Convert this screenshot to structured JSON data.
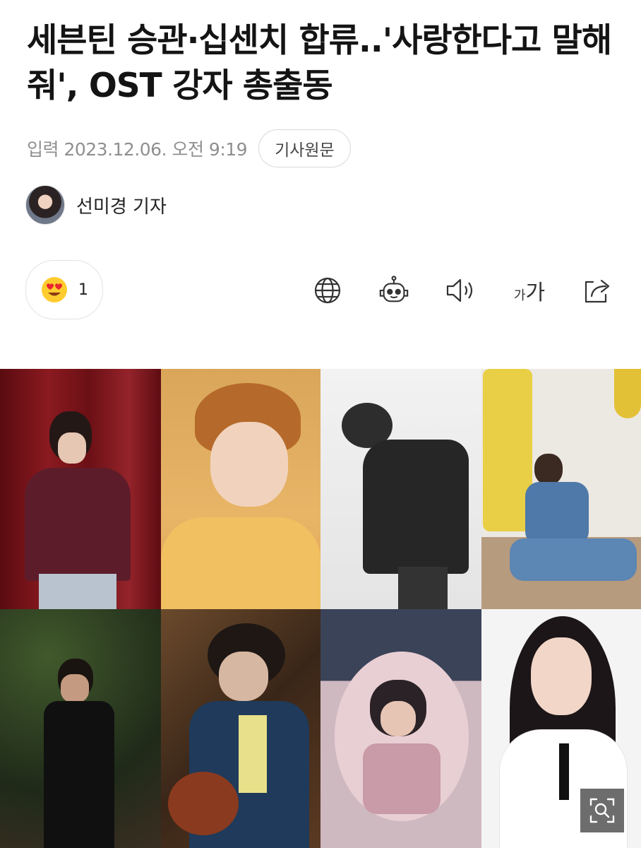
{
  "article": {
    "title": "세븐틴 승관·십센치 합류..'사랑한다고 말해줘', OST 강자 총출동",
    "date_label": "입력 2023.12.06. 오전 9:19",
    "source_button": "기사원문",
    "reporter": "선미경 기자"
  },
  "toolbar": {
    "reaction_count": "1",
    "icons": [
      "heart-eyes-emoji-icon",
      "globe-icon",
      "robot-icon",
      "speaker-icon",
      "font-size-icon",
      "share-icon"
    ],
    "font_small": "가",
    "font_large": "가"
  },
  "photo": {
    "panels": [
      "red-curtain",
      "yellow-knit",
      "black-white",
      "yellow-fridge",
      "ivy-wall",
      "guitar",
      "pink-blanket",
      "white-backdrop"
    ]
  },
  "colors": {
    "title": "#141414",
    "meta": "#8f8f8f",
    "border": "#d9d9d9"
  }
}
